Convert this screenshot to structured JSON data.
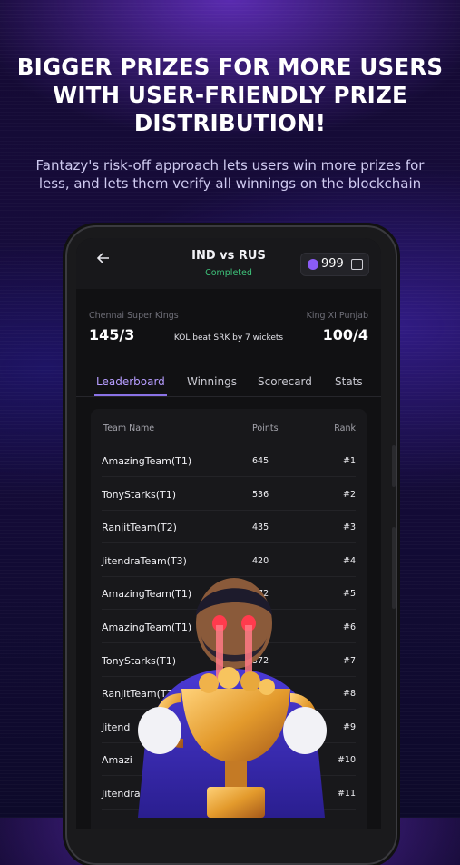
{
  "promo": {
    "headline": [
      "BIGGER PRIZES FOR MORE USERS",
      "WITH USER-FRIENDLY PRIZE",
      "DISTRIBUTION!"
    ],
    "subline": [
      "Fantazy's risk-off approach lets users win more prizes for",
      "less, and lets them verify all winnings on the blockchain"
    ]
  },
  "header": {
    "title": "IND vs RUS",
    "status": "Completed",
    "coins": "999",
    "back_icon": "arrow-left-icon",
    "wallet_icon": "wallet-icon"
  },
  "score": {
    "team_a": "Chennai Super Kings",
    "team_a_score": "145/3",
    "team_b": "King XI Punjab",
    "team_b_score": "100/4",
    "result": "KOL beat SRK by 7 wickets"
  },
  "tabs": [
    "Leaderboard",
    "Winnings",
    "Scorecard",
    "Stats"
  ],
  "leaderboard": {
    "columns": [
      "Team Name",
      "Points",
      "Rank"
    ],
    "rows": [
      {
        "team": "AmazingTeam(T1)",
        "points": "645",
        "rank": "#1"
      },
      {
        "team": "TonyStarks(T1)",
        "points": "536",
        "rank": "#2"
      },
      {
        "team": "RanjitTeam(T2)",
        "points": "435",
        "rank": "#3"
      },
      {
        "team": "JitendraTeam(T3)",
        "points": "420",
        "rank": "#4"
      },
      {
        "team": "AmazingTeam(T1)",
        "points": "372",
        "rank": "#5"
      },
      {
        "team": "AmazingTeam(T1)",
        "points": "",
        "rank": "#6"
      },
      {
        "team": "TonyStarks(T1)",
        "points": "372",
        "rank": "#7"
      },
      {
        "team": "RanjitTeam(T2)",
        "points": "",
        "rank": "#8"
      },
      {
        "team": "Jitend",
        "points": "",
        "rank": "#9"
      },
      {
        "team": "Amazi",
        "points": "",
        "rank": "#10"
      },
      {
        "team": "JitendraTeam(T3)",
        "points": "",
        "rank": "#11"
      }
    ]
  },
  "colors": {
    "accent": "#8a72e6",
    "status_green": "#3ec27a",
    "coin_purple": "#8b5cf6"
  }
}
